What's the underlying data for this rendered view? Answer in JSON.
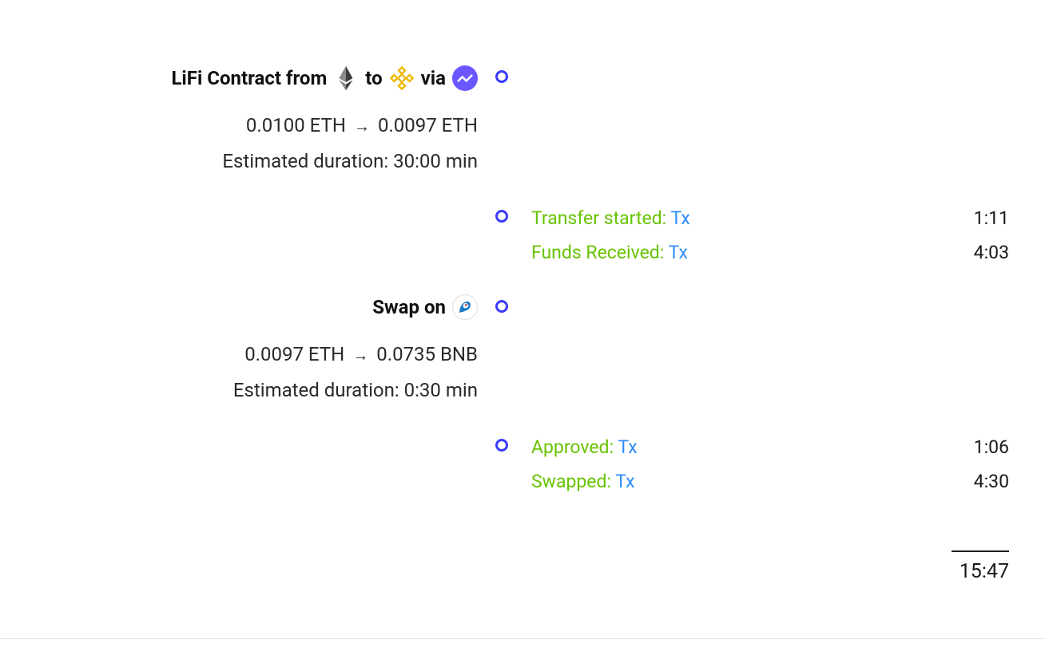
{
  "step1": {
    "title_prefix": "LiFi Contract from",
    "title_mid": "to",
    "title_suffix": "via",
    "from_amount": "0.0100 ETH",
    "to_amount": "0.0097 ETH",
    "duration_label": "Estimated duration: 30:00 min",
    "events": [
      {
        "label": "Transfer started:",
        "link": "Tx",
        "time": "1:11"
      },
      {
        "label": "Funds Received:",
        "link": "Tx",
        "time": "4:03"
      }
    ]
  },
  "step2": {
    "title": "Swap on",
    "from_amount": "0.0097 ETH",
    "to_amount": "0.0735 BNB",
    "duration_label": "Estimated duration: 0:30 min",
    "events": [
      {
        "label": "Approved:",
        "link": "Tx",
        "time": "1:06"
      },
      {
        "label": "Swapped:",
        "link": "Tx",
        "time": "4:30"
      }
    ]
  },
  "total_time": "15:47",
  "icons": {
    "eth": "ethereum-icon",
    "bnb": "bnb-chain-icon",
    "bridge": "bridge-provider-icon",
    "dex": "dex-provider-icon"
  }
}
